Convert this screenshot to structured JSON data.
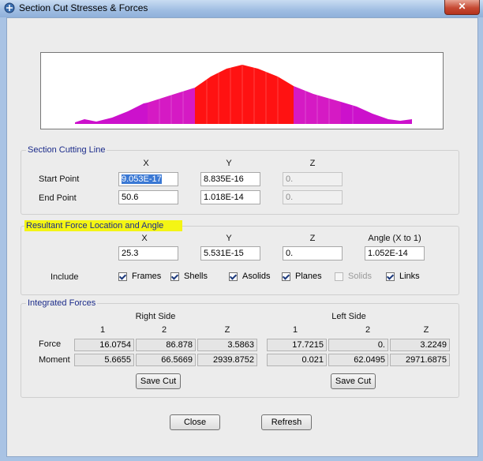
{
  "window": {
    "title": "Section Cut Stresses & Forces",
    "close_glyph": "✕"
  },
  "section_cutting_line": {
    "title": "Section Cutting Line",
    "headers": [
      "X",
      "Y",
      "Z"
    ],
    "start_label": "Start Point",
    "end_label": "End Point",
    "start": {
      "x": "9.053E-17",
      "y": "8.835E-16",
      "z": "0."
    },
    "end": {
      "x": "50.6",
      "y": "1.018E-14",
      "z": "0."
    }
  },
  "resultant": {
    "title": "Resultant Force Location and Angle",
    "headers": [
      "X",
      "Y",
      "Z",
      "Angle (X to 1)"
    ],
    "values": {
      "x": "25.3",
      "y": "5.531E-15",
      "z": "0.",
      "angle": "1.052E-14"
    },
    "include_label": "Include",
    "include": [
      {
        "label": "Frames",
        "checked": true,
        "enabled": true
      },
      {
        "label": "Shells",
        "checked": true,
        "enabled": true
      },
      {
        "label": "Asolids",
        "checked": true,
        "enabled": true
      },
      {
        "label": "Planes",
        "checked": true,
        "enabled": true
      },
      {
        "label": "Solids",
        "checked": false,
        "enabled": false
      },
      {
        "label": "Links",
        "checked": true,
        "enabled": true
      }
    ]
  },
  "integrated": {
    "title": "Integrated Forces",
    "right_title": "Right Side",
    "left_title": "Left Side",
    "col_headers": [
      "1",
      "2",
      "Z"
    ],
    "force_label": "Force",
    "moment_label": "Moment",
    "right": {
      "force": [
        "16.0754",
        "86.878",
        "3.5863"
      ],
      "moment": [
        "5.6655",
        "66.5669",
        "2939.8752"
      ]
    },
    "left": {
      "force": [
        "17.7215",
        "0.",
        "3.2249"
      ],
      "moment": [
        "0.021",
        "62.0495",
        "2971.6875"
      ]
    },
    "save_cut_label": "Save Cut"
  },
  "buttons": {
    "close": "Close",
    "refresh": "Refresh"
  },
  "colors": {
    "diagram_magenta": "#cc11cc",
    "diagram_red": "#ff1111",
    "highlight": "#f4f514",
    "group_title": "#1b2b8a"
  }
}
